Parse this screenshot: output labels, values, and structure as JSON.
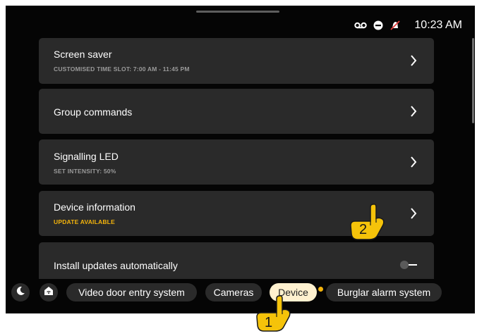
{
  "status": {
    "time": "10:23 AM",
    "icons": [
      "voicemail-icon",
      "do-not-disturb-icon",
      "bell-off-icon"
    ]
  },
  "settings": [
    {
      "title": "Screen saver",
      "subtitle": "CUSTOMISED TIME SLOT: 7:00 AM - 11:45 PM",
      "subtitle_color": "#9a9a9a",
      "control": "chevron-right-icon"
    },
    {
      "title": "Group commands",
      "subtitle": "",
      "control": "chevron-right-icon"
    },
    {
      "title": "Signalling LED",
      "subtitle": "SET INTENSITY: 50%",
      "subtitle_color": "#9a9a9a",
      "control": "chevron-right-icon"
    },
    {
      "title": "Device information",
      "subtitle": "UPDATE AVAILABLE",
      "subtitle_color": "#f4b40c",
      "control": "chevron-right-icon"
    },
    {
      "title": "Install updates automatically",
      "subtitle": "",
      "control": "toggle-switch",
      "toggle_on": false
    }
  ],
  "bottom_nav": {
    "icons": [
      "moon-icon",
      "home-icon"
    ],
    "tabs": [
      {
        "label": "Video door entry system",
        "active": false
      },
      {
        "label": "Cameras",
        "active": false
      },
      {
        "label": "Device",
        "active": true,
        "badge": true
      },
      {
        "label": "Burglar alarm system",
        "active": false
      }
    ]
  },
  "annotations": [
    {
      "label": "1",
      "icon": "pointing-hand-icon"
    },
    {
      "label": "2",
      "icon": "pointing-hand-icon"
    }
  ],
  "colors": {
    "accent": "#f4b40c",
    "card_bg": "#2a2a2a",
    "screen_bg": "#050505",
    "active_tab_bg": "#fff1cf"
  }
}
